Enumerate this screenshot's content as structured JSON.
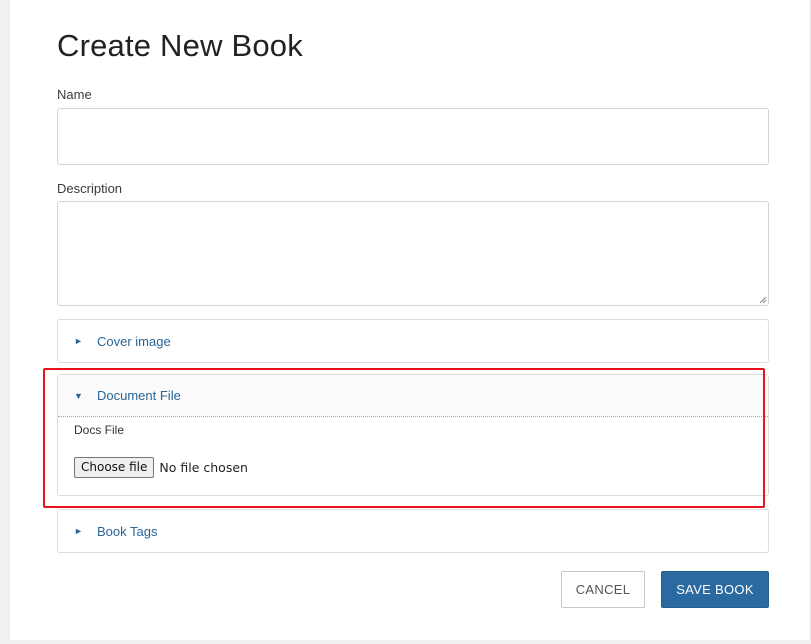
{
  "page": {
    "title": "Create New Book"
  },
  "form": {
    "name_label": "Name",
    "name_value": "",
    "description_label": "Description",
    "description_value": ""
  },
  "sections": {
    "cover_image": {
      "label": "Cover image",
      "expanded": false,
      "toggle_icon": "triangle-right-icon"
    },
    "document_file": {
      "label": "Document File",
      "expanded": true,
      "toggle_icon": "triangle-down-icon",
      "docs_label": "Docs File",
      "choose_button": "Choose file",
      "file_status": "No file chosen"
    },
    "book_tags": {
      "label": "Book Tags",
      "expanded": false,
      "toggle_icon": "triangle-right-icon"
    }
  },
  "actions": {
    "cancel_label": "CANCEL",
    "save_label": "SAVE BOOK"
  },
  "colors": {
    "accent": "#2a6aa0",
    "link": "#2a6496",
    "highlight": "#e8141c"
  }
}
